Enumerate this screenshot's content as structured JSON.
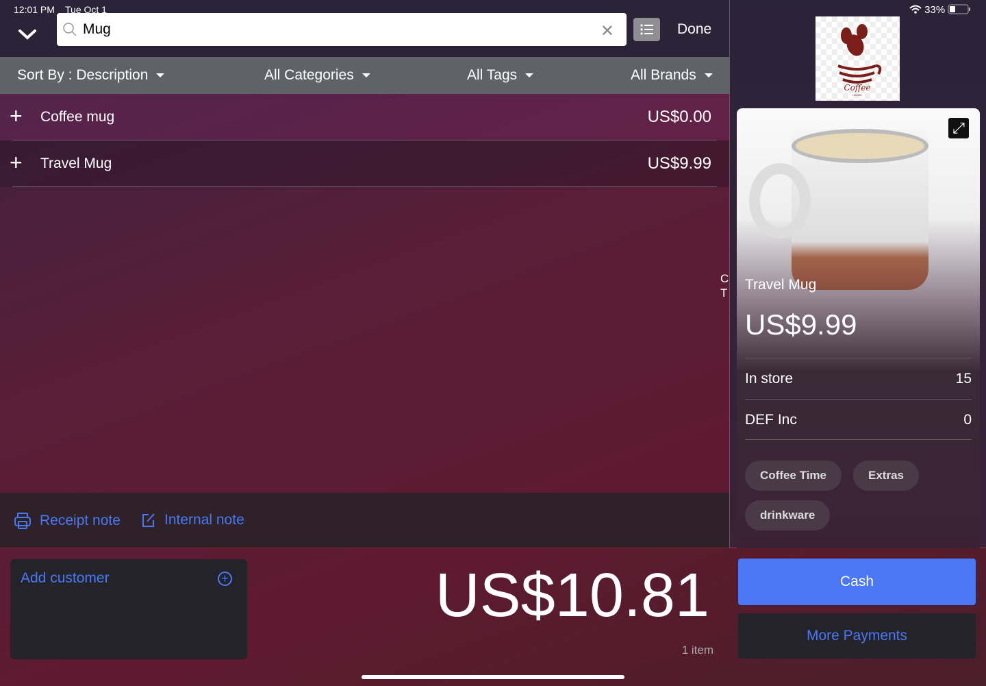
{
  "status": {
    "time": "12:01 PM",
    "date": "Tue Oct 1",
    "battery": "33%"
  },
  "search": {
    "value": "Mug",
    "done_label": "Done"
  },
  "filters": {
    "sort": "Sort By : Description",
    "categories": "All Categories",
    "tags": "All Tags",
    "brands": "All Brands"
  },
  "results": [
    {
      "name": "Coffee mug",
      "price": "US$0.00"
    },
    {
      "name": "Travel Mug",
      "price": "US$9.99"
    }
  ],
  "notes": {
    "receipt": "Receipt note",
    "internal": "Internal note"
  },
  "side_cut_text": [
    "C",
    "T"
  ],
  "logo": {
    "text": "Coffee",
    "subtext": "HOUSE"
  },
  "product": {
    "name": "Travel Mug",
    "price": "US$9.99",
    "stock": [
      {
        "location": "In store",
        "qty": "15"
      },
      {
        "location": "DEF Inc",
        "qty": "0"
      }
    ],
    "tags": [
      "Coffee Time",
      "Extras",
      "drinkware"
    ]
  },
  "customer": {
    "label": "Add customer"
  },
  "cart": {
    "total": "US$10.81",
    "count": "1 item"
  },
  "payments": {
    "cash": "Cash",
    "more": "More Payments"
  },
  "colors": {
    "accent": "#4a78f5",
    "filter_bar": "#5f6368"
  }
}
